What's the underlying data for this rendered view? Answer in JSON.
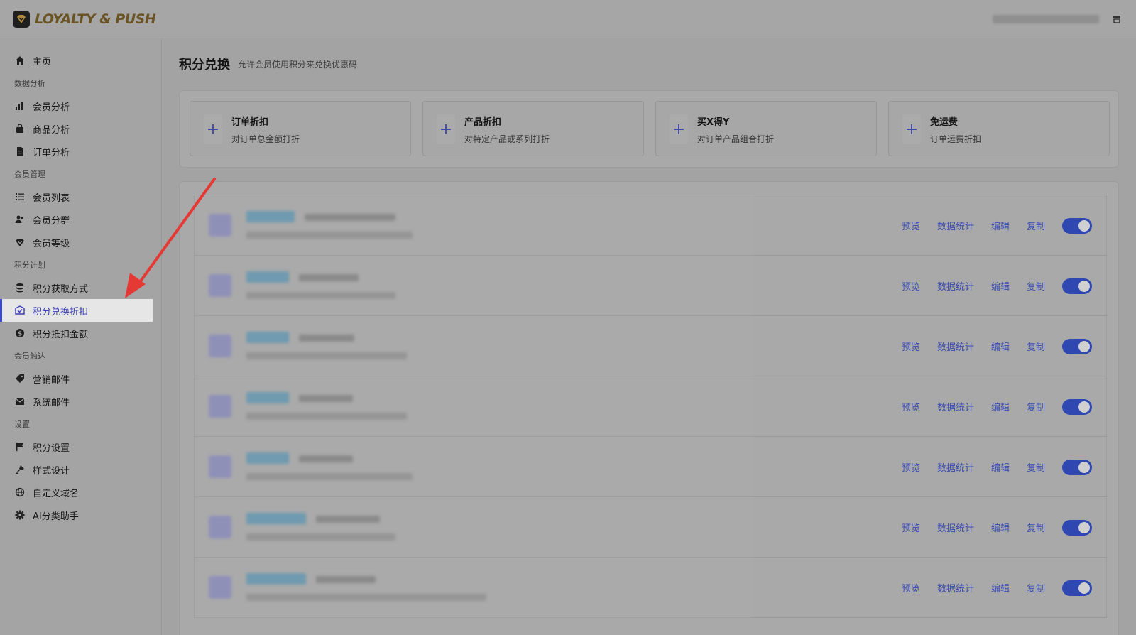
{
  "app": {
    "logo_text": "LOYALTY & PUSH"
  },
  "sidebar": {
    "home": "主页",
    "sections": [
      {
        "title": "数据分析",
        "items": [
          "会员分析",
          "商品分析",
          "订单分析"
        ]
      },
      {
        "title": "会员管理",
        "items": [
          "会员列表",
          "会员分群",
          "会员等级"
        ]
      },
      {
        "title": "积分计划",
        "items": [
          "积分获取方式",
          "积分兑换折扣",
          "积分抵扣金额"
        ]
      },
      {
        "title": "会员触达",
        "items": [
          "营销邮件",
          "系统邮件"
        ]
      },
      {
        "title": "设置",
        "items": [
          "积分设置",
          "样式设计",
          "自定义域名",
          "AI分类助手"
        ]
      }
    ],
    "active_item": "积分兑换折扣"
  },
  "main": {
    "title": "积分兑换",
    "subtitle": "允许会员使用积分来兑换优惠码",
    "types": [
      {
        "name": "订单折扣",
        "desc": "对订单总金额打折"
      },
      {
        "name": "产品折扣",
        "desc": "对特定产品或系列打折"
      },
      {
        "name": "买X得Y",
        "desc": "对订单产品组合打折"
      },
      {
        "name": "免运费",
        "desc": "订单运费折扣"
      }
    ],
    "row_actions": {
      "preview": "预览",
      "stats": "数据统计",
      "edit": "编辑",
      "copy": "复制"
    },
    "rows": 7
  },
  "colors": {
    "accent": "#3b49d1",
    "annotation_arrow": "#e53935"
  }
}
